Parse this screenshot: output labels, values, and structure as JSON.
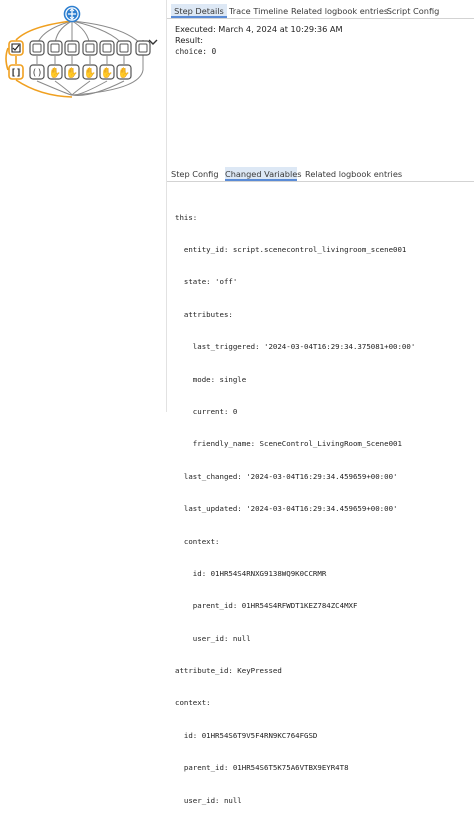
{
  "top_tabs": [
    "Step Details",
    "Trace Timeline",
    "Related logbook entries",
    "Script Config"
  ],
  "step_details": {
    "executed": "Executed: March 4, 2024 at 10:29:36 AM",
    "result_label": "Result:",
    "choice": "choice: 0"
  },
  "bottom_tabs": [
    "Step Config",
    "Changed Variables",
    "Related logbook entries"
  ],
  "variables_lines": [
    "this:",
    "  entity_id: script.scenecontrol_livingroom_scene001",
    "  state: 'off'",
    "  attributes:",
    "    last_triggered: '2024-03-04T16:29:34.375081+00:00'",
    "    mode: single",
    "    current: 0",
    "    friendly_name: SceneControl_LivingRoom_Scene001",
    "  last_changed: '2024-03-04T16:29:34.459659+00:00'",
    "  last_updated: '2024-03-04T16:29:34.459659+00:00'",
    "  context:",
    "    id: 01HR54S4RNXG9138WQ9K0CCRMR",
    "    parent_id: 01HR54S4RFWDT1KEZ784ZC4MXF",
    "    user_id: null",
    "attribute_id: KeyPressed",
    "context:",
    "  id: 01HR54S6T9V5F4RN9KC764FGSD",
    "  parent_id: 01HR54S6T5K75A6VTBX9EYR4T8",
    "  user_id: null"
  ],
  "colors": {
    "trace_path": "#f0a020",
    "active_tab": "#dde8f5",
    "node_stroke": "#555555"
  }
}
